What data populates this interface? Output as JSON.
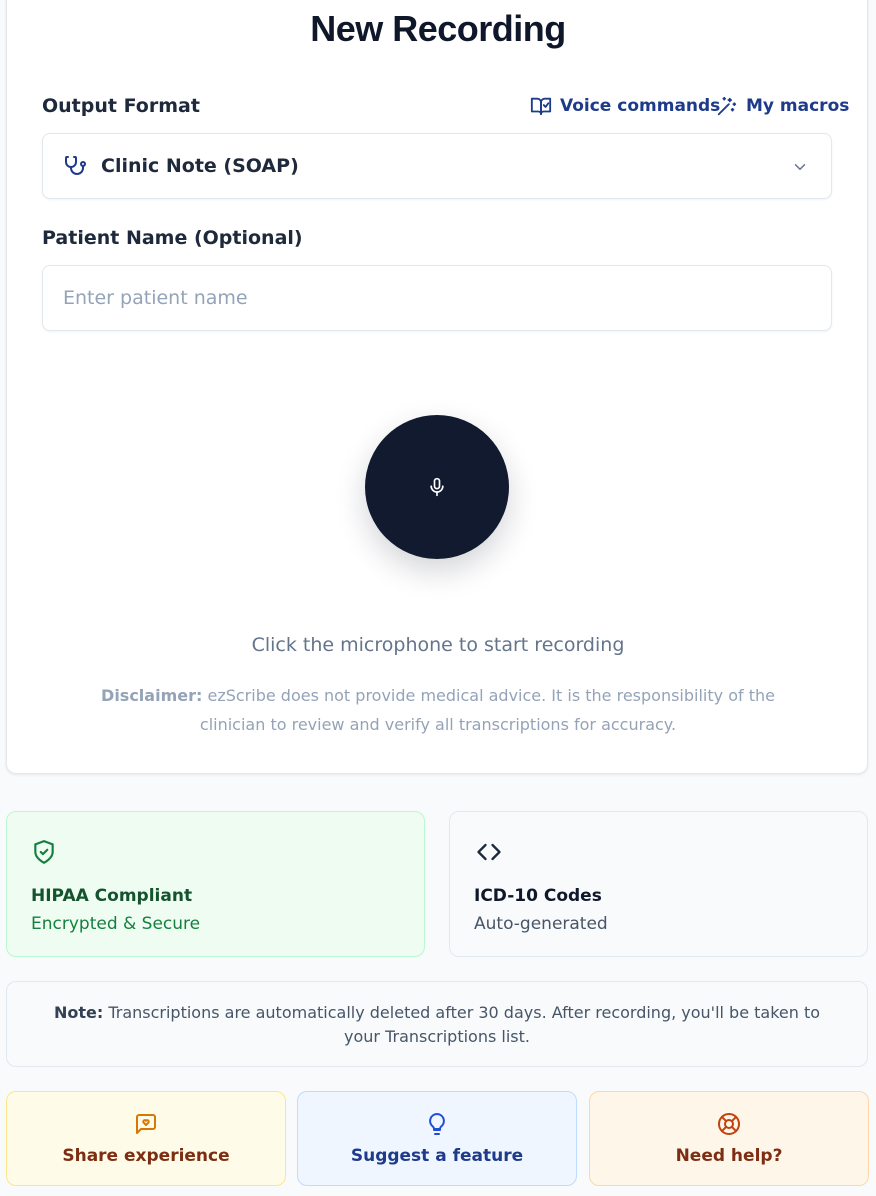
{
  "page": {
    "title": "New Recording"
  },
  "output_format": {
    "label": "Output Format",
    "selected": "Clinic Note (SOAP)",
    "voice_commands_label": "Voice commands",
    "my_macros_label": "My macros"
  },
  "patient": {
    "label": "Patient Name (Optional)",
    "placeholder": "Enter patient name",
    "value": ""
  },
  "recorder": {
    "hint": "Click the microphone to start recording",
    "disclaimer_bold": "Disclaimer:",
    "disclaimer_text": " ezScribe does not provide medical advice. It is the responsibility of the clinician to review and verify all transcriptions for accuracy."
  },
  "features": [
    {
      "title": "HIPAA Compliant",
      "subtitle": "Encrypted & Secure",
      "icon": "shield-check-icon"
    },
    {
      "title": "ICD-10 Codes",
      "subtitle": "Auto-generated",
      "icon": "code-icon"
    }
  ],
  "note": {
    "bold": "Note:",
    "text": " Transcriptions are automatically deleted after 30 days. After recording, you'll be taken to your Transcriptions list."
  },
  "actions": [
    {
      "label": "Share experience",
      "icon": "message-heart-icon"
    },
    {
      "label": "Suggest a feature",
      "icon": "lightbulb-icon"
    },
    {
      "label": "Need help?",
      "icon": "life-buoy-icon"
    }
  ],
  "colors": {
    "accent_dark": "#111a2e",
    "link_blue": "#1e3a8a",
    "success_green": "#15803d",
    "warning_orange": "#d97706",
    "danger_orange": "#c2410c"
  }
}
